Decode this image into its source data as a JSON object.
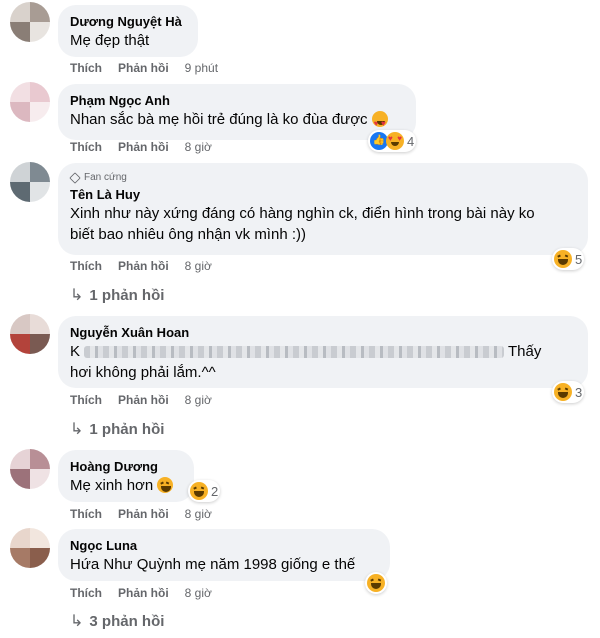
{
  "actions": {
    "like": "Thích",
    "reply": "Phản hồi"
  },
  "comments": [
    {
      "name": "Dương Nguyệt Hà",
      "text": "Mẹ đẹp thật",
      "time": "9 phút",
      "avatar_colors": [
        "#d9d2cc",
        "#a89c94",
        "#e8e4e0",
        "#8a7e76"
      ]
    },
    {
      "name": "Phạm Ngọc Anh",
      "text": "Nhan sắc bà mẹ hồi trẻ đúng là ko đùa được",
      "time": "8 giờ",
      "reaction_count": "4",
      "reaction_icons": [
        "like",
        "love-eyes-emoji"
      ],
      "avatar_colors": [
        "#f2dfe3",
        "#e9c9d0",
        "#f7ecee",
        "#dcb8c0"
      ]
    },
    {
      "badge": "Fan cứng",
      "name": "Tên Là Huy",
      "text_lines": [
        "Xinh như này xứng đáng có hàng nghìn ck, điển hình trong bài này ko",
        "biết bao nhiêu ông nhận vk mình :))"
      ],
      "time": "8 giờ",
      "reaction_count": "5",
      "replies": "1 phản hồi",
      "avatar_colors": [
        "#cfd3d6",
        "#7f8a92",
        "#e1e4e6",
        "#5e6a72"
      ]
    },
    {
      "name": "Nguyễn Xuân Hoan",
      "text_start": "K",
      "text_end": "Thấy",
      "text_line2": "hơi không phải lắm.^^",
      "time": "8 giờ",
      "reaction_count": "3",
      "replies": "1 phản hồi",
      "avatar_colors": [
        "#d8c8c4",
        "#b3433b",
        "#e8dcd8",
        "#7a5a52"
      ]
    },
    {
      "name": "Hoàng Dương",
      "text": "Mẹ xinh hơn",
      "time": "8 giờ",
      "reaction_count": "2",
      "avatar_colors": [
        "#e6d3d6",
        "#b88f96",
        "#efe2e4",
        "#9c727a"
      ]
    },
    {
      "name": "Ngọc Luna",
      "text": "Hứa Như Quỳnh mẹ năm 1998 giống e thế",
      "time": "8 giờ",
      "replies": "3 phản hồi",
      "avatar_colors": [
        "#e8d6cc",
        "#a67a66",
        "#f2e6de",
        "#8a5e4c"
      ]
    }
  ],
  "colors": {
    "bubble": "#f0f2f5",
    "meta": "#65676b",
    "haha": "#f7b125",
    "like": "#1877f2"
  }
}
